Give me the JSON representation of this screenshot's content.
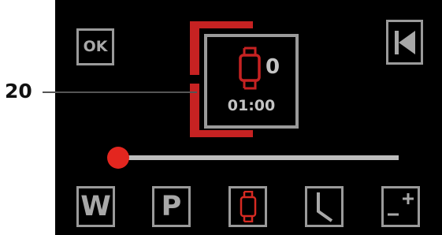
{
  "callout": {
    "number": "20"
  },
  "buttons": {
    "ok_label": "OK",
    "back_icon": "skip-back-icon"
  },
  "status": {
    "icon": "wristwatch-icon",
    "counter": "0",
    "time": "01:00"
  },
  "slider": {
    "value_fraction": 0.0
  },
  "mode_buttons": [
    {
      "label": "W",
      "icon": ""
    },
    {
      "label": "P",
      "icon": ""
    },
    {
      "label": "",
      "icon": "wristwatch-icon",
      "active": true
    },
    {
      "label": "",
      "icon": "clock-hands-icon"
    },
    {
      "label": "",
      "icon": "plus-minus-icon"
    }
  ],
  "colors": {
    "accent_red": "#c62222",
    "thumb_red": "#e3261f",
    "button_gray": "#9a9a9a",
    "text_light": "#c4c4c4",
    "screen_background": "#000000"
  }
}
